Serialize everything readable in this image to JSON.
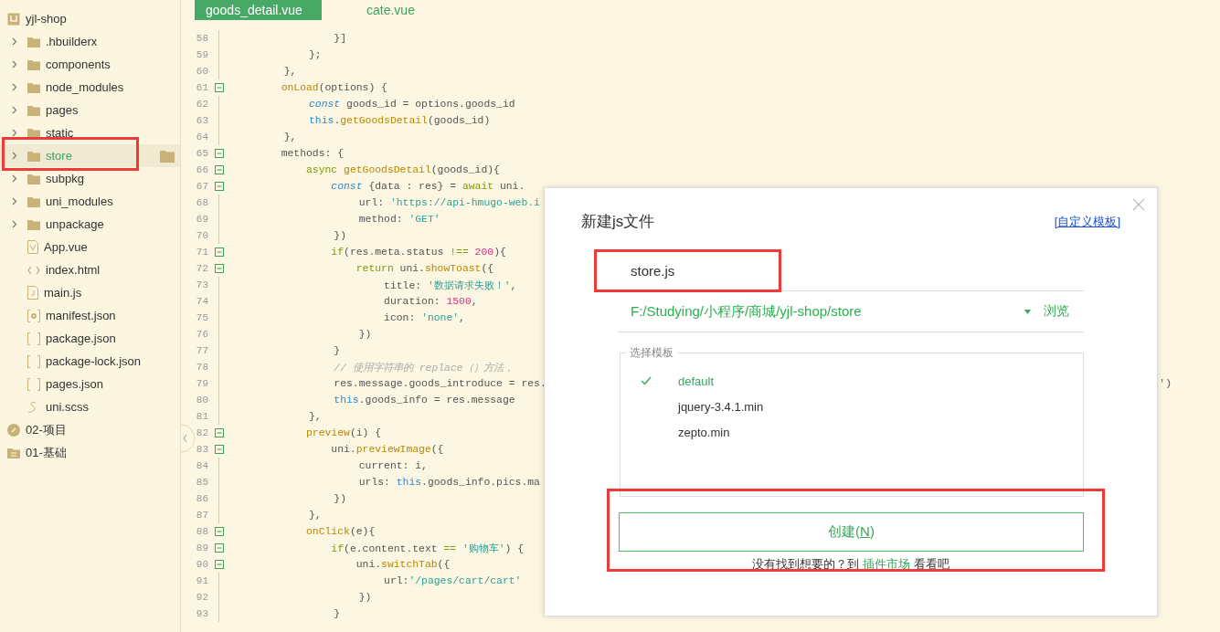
{
  "sidebar": {
    "items": [
      {
        "label": "yjl-shop",
        "kind": "root",
        "selected": false,
        "highlighted": false,
        "children": [
          {
            "label": ".hbuilderx",
            "kind": "folder",
            "selected": false,
            "highlighted": false
          },
          {
            "label": "components",
            "kind": "folder",
            "selected": false,
            "highlighted": false
          },
          {
            "label": "node_modules",
            "kind": "folder",
            "selected": false,
            "highlighted": false
          },
          {
            "label": "pages",
            "kind": "folder",
            "selected": false,
            "highlighted": false
          },
          {
            "label": "static",
            "kind": "folder",
            "selected": false,
            "highlighted": false
          },
          {
            "label": "store",
            "kind": "folder",
            "selected": true,
            "highlighted": true
          },
          {
            "label": "subpkg",
            "kind": "folder",
            "selected": false,
            "highlighted": false
          },
          {
            "label": "uni_modules",
            "kind": "folder",
            "selected": false,
            "highlighted": false
          },
          {
            "label": "unpackage",
            "kind": "folder",
            "selected": false,
            "highlighted": false
          },
          {
            "label": "App.vue",
            "kind": "vue-file",
            "selected": false,
            "highlighted": false
          },
          {
            "label": "index.html",
            "kind": "html-file",
            "selected": false,
            "highlighted": false
          },
          {
            "label": "main.js",
            "kind": "js-file",
            "selected": false,
            "highlighted": false
          },
          {
            "label": "manifest.json",
            "kind": "config-file",
            "selected": false,
            "highlighted": false
          },
          {
            "label": "package.json",
            "kind": "json-file",
            "selected": false,
            "highlighted": false
          },
          {
            "label": "package-lock.json",
            "kind": "json-file",
            "selected": false,
            "highlighted": false
          },
          {
            "label": "pages.json",
            "kind": "json-file",
            "selected": false,
            "highlighted": false
          },
          {
            "label": "uni.scss",
            "kind": "style-file",
            "selected": false,
            "highlighted": false
          }
        ]
      },
      {
        "label": "02-项目",
        "kind": "linked-project",
        "selected": false,
        "highlighted": false
      },
      {
        "label": "01-基础",
        "kind": "folder-project",
        "selected": false,
        "highlighted": false
      }
    ]
  },
  "tabs": [
    {
      "label": "goods_detail.vue",
      "selected": true
    },
    {
      "label": "cate.vue",
      "selected": false
    }
  ],
  "editor": {
    "lines": [
      {
        "number": "58",
        "fold": false,
        "tokens": [
          {
            "text": "                }]",
            "kind": "plain"
          }
        ]
      },
      {
        "number": "59",
        "fold": false,
        "tokens": [
          {
            "text": "            };",
            "kind": "plain"
          }
        ]
      },
      {
        "number": "60",
        "fold": false,
        "tokens": [
          {
            "text": "        },",
            "kind": "plain"
          }
        ]
      },
      {
        "number": "61",
        "fold": true,
        "tokens": [
          {
            "text": "        onLoad",
            "kind": "function"
          },
          {
            "text": "(options) {",
            "kind": "plain"
          }
        ]
      },
      {
        "number": "62",
        "fold": false,
        "tokens": [
          {
            "text": "            const",
            "kind": "storage"
          },
          {
            "text": " goods_id = options.goods_id",
            "kind": "plain"
          }
        ]
      },
      {
        "number": "63",
        "fold": false,
        "tokens": [
          {
            "text": "            this",
            "kind": "this"
          },
          {
            "text": ".",
            "kind": "plain"
          },
          {
            "text": "getGoodsDetail",
            "kind": "function"
          },
          {
            "text": "(goods_id)",
            "kind": "plain"
          }
        ]
      },
      {
        "number": "64",
        "fold": false,
        "tokens": [
          {
            "text": "        },",
            "kind": "plain"
          }
        ]
      },
      {
        "number": "65",
        "fold": true,
        "tokens": [
          {
            "text": "        methods: {",
            "kind": "plain"
          }
        ]
      },
      {
        "number": "66",
        "fold": true,
        "tokens": [
          {
            "text": "            async",
            "kind": "keyword"
          },
          {
            "text": " getGoodsDetail",
            "kind": "function"
          },
          {
            "text": "(goods_id){",
            "kind": "plain"
          }
        ]
      },
      {
        "number": "67",
        "fold": true,
        "tokens": [
          {
            "text": "                const",
            "kind": "storage"
          },
          {
            "text": " {data : res} = ",
            "kind": "plain"
          },
          {
            "text": "await",
            "kind": "keyword"
          },
          {
            "text": " uni.",
            "kind": "plain"
          }
        ]
      },
      {
        "number": "68",
        "fold": false,
        "tokens": [
          {
            "text": "                    url: ",
            "kind": "plain"
          },
          {
            "text": "'https://api-hmugo-web.i",
            "kind": "string"
          }
        ]
      },
      {
        "number": "69",
        "fold": false,
        "tokens": [
          {
            "text": "                    method: ",
            "kind": "plain"
          },
          {
            "text": "'GET'",
            "kind": "string"
          }
        ]
      },
      {
        "number": "70",
        "fold": false,
        "tokens": [
          {
            "text": "                })",
            "kind": "plain"
          }
        ]
      },
      {
        "number": "71",
        "fold": true,
        "tokens": [
          {
            "text": "                if",
            "kind": "keyword"
          },
          {
            "text": "(res.meta.status ",
            "kind": "plain"
          },
          {
            "text": "!== ",
            "kind": "keyword"
          },
          {
            "text": "200",
            "kind": "number"
          },
          {
            "text": "){",
            "kind": "plain"
          }
        ]
      },
      {
        "number": "72",
        "fold": true,
        "tokens": [
          {
            "text": "                    return",
            "kind": "keyword"
          },
          {
            "text": " uni.",
            "kind": "plain"
          },
          {
            "text": "showToast",
            "kind": "function"
          },
          {
            "text": "({",
            "kind": "plain"
          }
        ]
      },
      {
        "number": "73",
        "fold": false,
        "tokens": [
          {
            "text": "                        title: ",
            "kind": "plain"
          },
          {
            "text": "'数据请求失败！'",
            "kind": "string"
          },
          {
            "text": ",",
            "kind": "plain"
          }
        ]
      },
      {
        "number": "74",
        "fold": false,
        "tokens": [
          {
            "text": "                        duration: ",
            "kind": "plain"
          },
          {
            "text": "1500",
            "kind": "number"
          },
          {
            "text": ",",
            "kind": "plain"
          }
        ]
      },
      {
        "number": "75",
        "fold": false,
        "tokens": [
          {
            "text": "                        icon: ",
            "kind": "plain"
          },
          {
            "text": "'none'",
            "kind": "string"
          },
          {
            "text": ",",
            "kind": "plain"
          }
        ]
      },
      {
        "number": "76",
        "fold": false,
        "tokens": [
          {
            "text": "                    })",
            "kind": "plain"
          }
        ]
      },
      {
        "number": "77",
        "fold": false,
        "tokens": [
          {
            "text": "                }",
            "kind": "plain"
          }
        ]
      },
      {
        "number": "78",
        "fold": false,
        "tokens": [
          {
            "text": "                // 使用字符串的 replace（）方法，",
            "kind": "comment"
          }
        ]
      },
      {
        "number": "79",
        "fold": false,
        "tokens": [
          {
            "text": "                res.message.goods_introduce = res.",
            "kind": "plain"
          }
        ],
        "tail": "')"
      },
      {
        "number": "80",
        "fold": false,
        "tokens": [
          {
            "text": "                this",
            "kind": "this"
          },
          {
            "text": ".goods_info = res.message",
            "kind": "plain"
          }
        ]
      },
      {
        "number": "81",
        "fold": false,
        "tokens": [
          {
            "text": "            },",
            "kind": "plain"
          }
        ]
      },
      {
        "number": "82",
        "fold": true,
        "tokens": [
          {
            "text": "            preview",
            "kind": "function"
          },
          {
            "text": "(i) {",
            "kind": "plain"
          }
        ]
      },
      {
        "number": "83",
        "fold": true,
        "tokens": [
          {
            "text": "                uni.",
            "kind": "plain"
          },
          {
            "text": "previewImage",
            "kind": "function"
          },
          {
            "text": "({",
            "kind": "plain"
          }
        ]
      },
      {
        "number": "84",
        "fold": false,
        "tokens": [
          {
            "text": "                    current: i,",
            "kind": "plain"
          }
        ]
      },
      {
        "number": "85",
        "fold": false,
        "tokens": [
          {
            "text": "                    urls: ",
            "kind": "plain"
          },
          {
            "text": "this",
            "kind": "this"
          },
          {
            "text": ".goods_info.pics.ma",
            "kind": "plain"
          }
        ]
      },
      {
        "number": "86",
        "fold": false,
        "tokens": [
          {
            "text": "                })",
            "kind": "plain"
          }
        ]
      },
      {
        "number": "87",
        "fold": false,
        "tokens": [
          {
            "text": "            },",
            "kind": "plain"
          }
        ]
      },
      {
        "number": "88",
        "fold": true,
        "tokens": [
          {
            "text": "            onClick",
            "kind": "function"
          },
          {
            "text": "(e){",
            "kind": "plain"
          }
        ]
      },
      {
        "number": "89",
        "fold": true,
        "tokens": [
          {
            "text": "                if",
            "kind": "keyword"
          },
          {
            "text": "(e.content.text ",
            "kind": "plain"
          },
          {
            "text": "== ",
            "kind": "keyword"
          },
          {
            "text": "'购物车'",
            "kind": "string"
          },
          {
            "text": ") {",
            "kind": "plain"
          }
        ]
      },
      {
        "number": "90",
        "fold": true,
        "tokens": [
          {
            "text": "                    uni.",
            "kind": "plain"
          },
          {
            "text": "switchTab",
            "kind": "function"
          },
          {
            "text": "({",
            "kind": "plain"
          }
        ]
      },
      {
        "number": "91",
        "fold": false,
        "tokens": [
          {
            "text": "                        url:",
            "kind": "plain"
          },
          {
            "text": "'/pages/cart/cart'",
            "kind": "string"
          }
        ]
      },
      {
        "number": "92",
        "fold": false,
        "tokens": [
          {
            "text": "                    })",
            "kind": "plain"
          }
        ]
      },
      {
        "number": "93",
        "fold": false,
        "tokens": [
          {
            "text": "                }",
            "kind": "plain"
          }
        ]
      }
    ]
  },
  "dialog": {
    "title": "新建js文件",
    "template_link": "[自定义模板]",
    "name_field": {
      "value": "store.js",
      "highlighted": true
    },
    "path": {
      "value": "F:/Studying/小程序/商城/yjl-shop/store",
      "browse": "浏览"
    },
    "templates": {
      "legend": "选择模板",
      "items": [
        {
          "label": "default",
          "selected": true
        },
        {
          "label": "jquery-3.4.1.min",
          "selected": false
        },
        {
          "label": "zepto.min",
          "selected": false
        }
      ]
    },
    "create_button": {
      "label_parts": [
        "创建(",
        "N",
        ")"
      ],
      "highlighted": true
    },
    "hint": {
      "before": "没有找到想要的？到",
      "link": "插件市场",
      "after": "看看吧"
    }
  }
}
